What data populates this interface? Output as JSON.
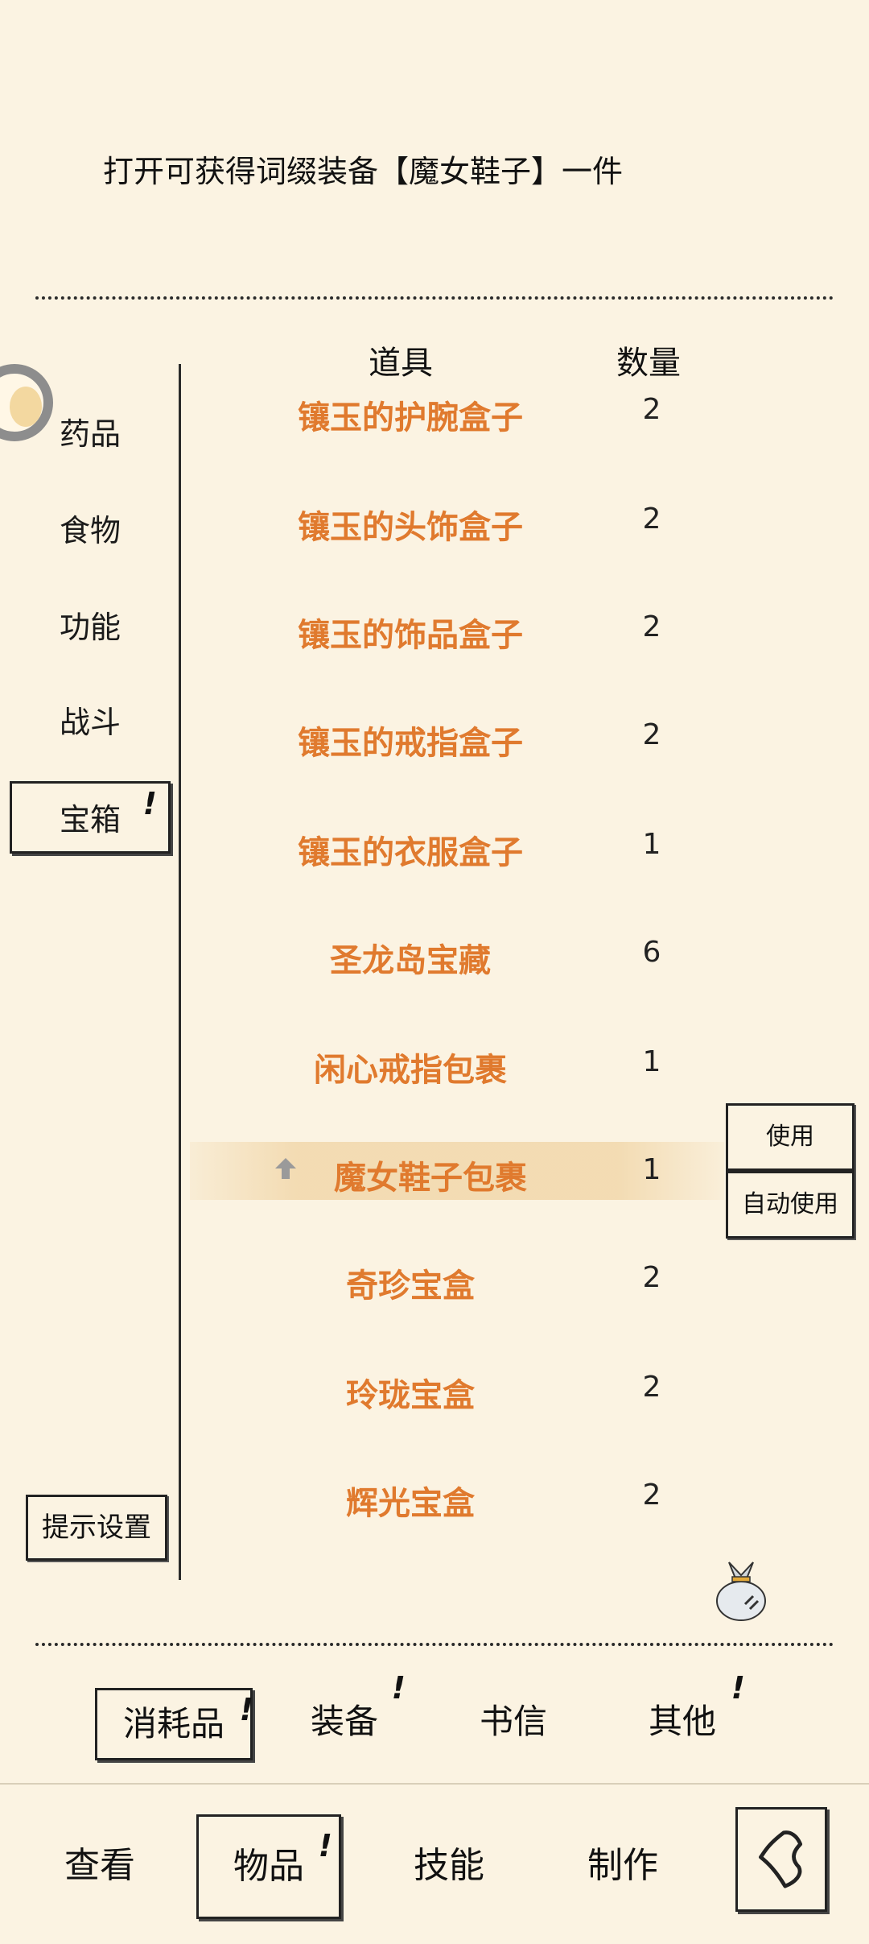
{
  "description": "打开可获得词缀装备【魔女鞋子】一件",
  "categories": {
    "items": [
      {
        "label": "药品"
      },
      {
        "label": "食物"
      },
      {
        "label": "功能"
      },
      {
        "label": "战斗"
      },
      {
        "label": "宝箱",
        "selected": true,
        "mark": "!"
      }
    ],
    "tip_settings": "提示设置"
  },
  "table": {
    "header_item": "道具",
    "header_qty": "数量",
    "rows": [
      {
        "name": "镶玉的护腕盒子",
        "qty": "2"
      },
      {
        "name": "镶玉的头饰盒子",
        "qty": "2"
      },
      {
        "name": "镶玉的饰品盒子",
        "qty": "2"
      },
      {
        "name": "镶玉的戒指盒子",
        "qty": "2"
      },
      {
        "name": "镶玉的衣服盒子",
        "qty": "1"
      },
      {
        "name": "圣龙岛宝藏",
        "qty": "6"
      },
      {
        "name": "闲心戒指包裹",
        "qty": "1"
      },
      {
        "name": "魔女鞋子包裹",
        "qty": "1",
        "selected": true
      },
      {
        "name": "奇珍宝盒",
        "qty": "2"
      },
      {
        "name": "玲珑宝盒",
        "qty": "2"
      },
      {
        "name": "辉光宝盒",
        "qty": "2"
      }
    ]
  },
  "actions": {
    "use": "使用",
    "auto_use": "自动使用"
  },
  "subtabs": [
    {
      "label": "消耗品",
      "selected": true,
      "mark": "!"
    },
    {
      "label": "装备",
      "mark": "!"
    },
    {
      "label": "书信"
    },
    {
      "label": "其他",
      "mark": "!"
    }
  ],
  "nav": [
    {
      "label": "查看"
    },
    {
      "label": "物品",
      "selected": true,
      "mark": "!"
    },
    {
      "label": "技能"
    },
    {
      "label": "制作"
    }
  ],
  "colors": {
    "background": "#fbf3e2",
    "item_name": "#e07a2e",
    "highlight": "#ecc88c"
  }
}
